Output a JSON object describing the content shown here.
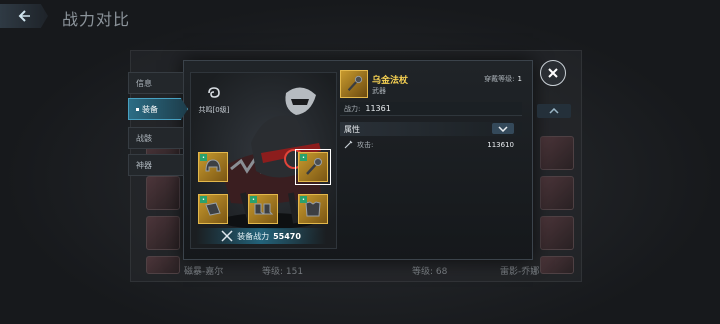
{
  "header": {
    "title": "战力对比"
  },
  "tabs": [
    {
      "label": "信息",
      "active": false
    },
    {
      "label": "装备",
      "active": true
    },
    {
      "label": "战骸",
      "active": false
    },
    {
      "label": "神器",
      "active": false
    }
  ],
  "character": {
    "resonance_label": "共鸣[0级]",
    "equip_power_label": "装备战力",
    "equip_power_value": "55470"
  },
  "item": {
    "name": "乌金法杖",
    "type": "武器",
    "wear_level_label": "穿戴等级:",
    "wear_level_value": "1",
    "combat_label": "战力:",
    "combat_value": "11361",
    "attr_header": "属性",
    "attr_name": "攻击:",
    "attr_value": "113610"
  },
  "background": {
    "left_name": "磁暴-嘉尔",
    "left_level": "等级: 151",
    "mid_level": "等级: 68",
    "right_name": "雷影-乔娜"
  },
  "icons": {
    "back": "back-arrow-icon",
    "close": "close-icon",
    "expand": "chevron-down-icon",
    "up": "chevron-up-icon",
    "resonance": "swirl-icon",
    "power": "crossed-swords-icon",
    "attack": "sword-icon"
  },
  "colors": {
    "accent": "#2c6d85",
    "gold": "#f4cf52",
    "quality": "#c89a2e"
  }
}
